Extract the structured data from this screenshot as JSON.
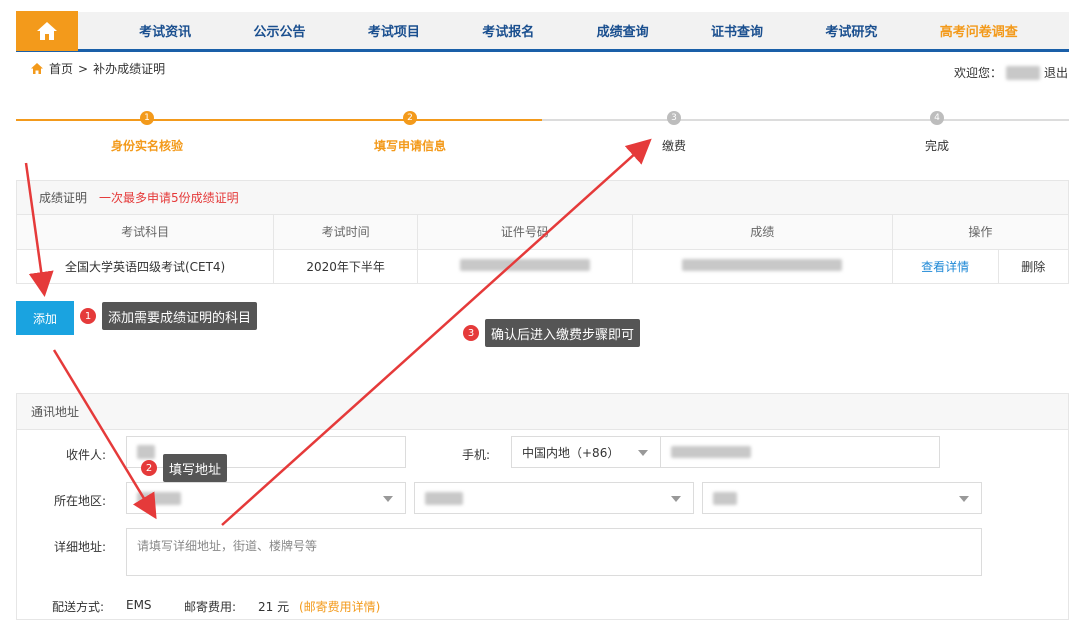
{
  "nav": {
    "items": [
      "考试资讯",
      "公示公告",
      "考试项目",
      "考试报名",
      "成绩查询",
      "证书查询",
      "考试研究"
    ],
    "highlight_item": "高考问卷调查"
  },
  "breadcrumb": {
    "home": "首页",
    "separator": ">",
    "current": "补办成绩证明"
  },
  "welcome": {
    "prefix": "欢迎您：",
    "logout": "退出"
  },
  "steps": [
    {
      "num": "1",
      "label": "身份实名核验",
      "state": "done"
    },
    {
      "num": "2",
      "label": "填写申请信息",
      "state": "done"
    },
    {
      "num": "3",
      "label": "缴费",
      "state": "todo"
    },
    {
      "num": "4",
      "label": "完成",
      "state": "todo"
    }
  ],
  "certificate": {
    "title": "成绩证明",
    "limit_note": "一次最多申请5份成绩证明",
    "columns": [
      "考试科目",
      "考试时间",
      "证件号码",
      "成绩",
      "操作"
    ],
    "row": {
      "subject": "全国大学英语四级考试(CET4)",
      "time": "2020年下半年",
      "view": "查看详情",
      "delete": "删除"
    }
  },
  "add_button": "添加",
  "tips": {
    "t1": {
      "num": "1",
      "text": "添加需要成绩证明的科目"
    },
    "t2": {
      "num": "2",
      "text": "填写地址"
    },
    "t3": {
      "num": "3",
      "text": "确认后进入缴费步骤即可"
    }
  },
  "address": {
    "title": "通讯地址",
    "recipient_label": "收件人:",
    "phone_label": "手机:",
    "phone_region": "中国内地（+86）",
    "region_label": "所在地区:",
    "detail_label": "详细地址:",
    "detail_placeholder": "请填写详细地址，街道、楼牌号等",
    "shipping_label": "配送方式:",
    "shipping_value": "EMS",
    "fee_label": "邮寄费用:",
    "fee_value": "21 元",
    "fee_link": "(邮寄费用详情)"
  },
  "colors": {
    "brand_blue": "#1a4f8f",
    "accent_orange": "#f39a1b",
    "button_blue": "#1aa3e0",
    "alert_red": "#e53a3a"
  }
}
